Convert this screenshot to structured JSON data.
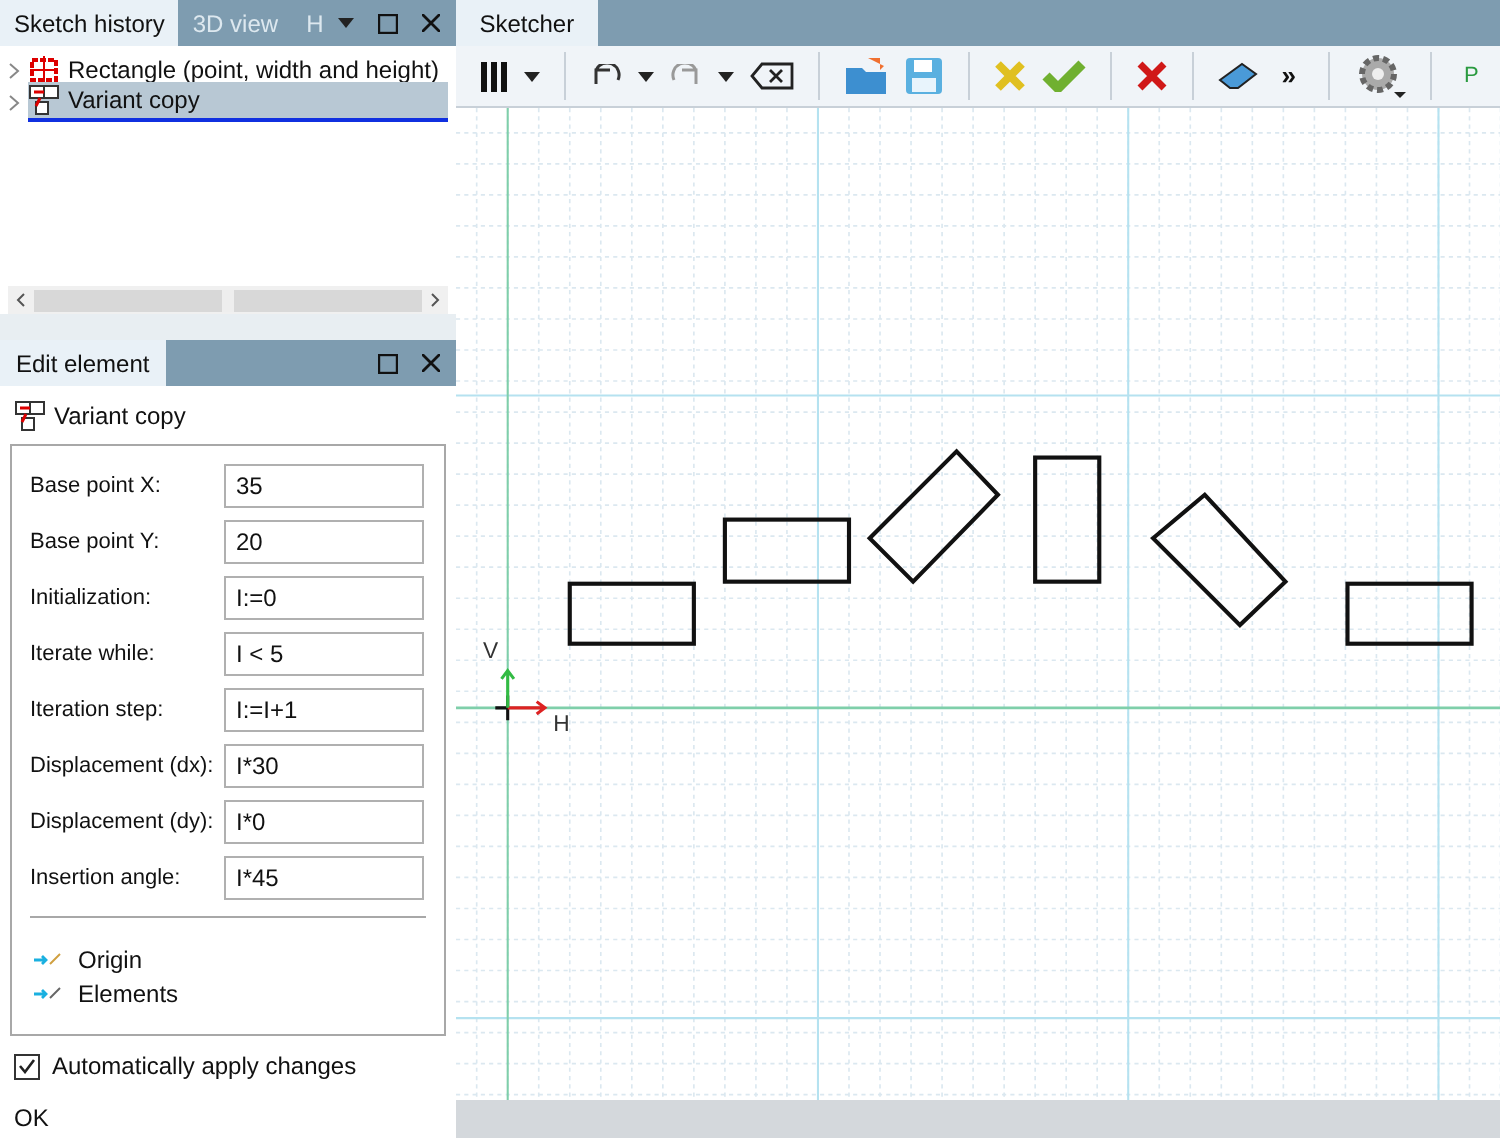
{
  "left_tabs": [
    {
      "label": "Sketch history",
      "selected": true
    },
    {
      "label": "3D view",
      "selected": false
    },
    {
      "label": "H",
      "selected": false
    }
  ],
  "sketch_history": [
    {
      "label": "Rectangle (point, width and height)",
      "selected": false,
      "kind": "rectangle"
    },
    {
      "label": "Variant copy",
      "selected": true,
      "kind": "variant"
    }
  ],
  "edit_panel": {
    "tab": "Edit element",
    "element_title": "Variant copy",
    "fields": [
      {
        "label": "Base point X:",
        "value": "35"
      },
      {
        "label": "Base point Y:",
        "value": "20"
      },
      {
        "label": "Initialization:",
        "value": "I:=0"
      },
      {
        "label": "Iterate while:",
        "value": "I < 5"
      },
      {
        "label": "Iteration step:",
        "value": "I:=I+1"
      },
      {
        "label": "Displacement (dx):",
        "value": "I*30"
      },
      {
        "label": "Displacement (dy):",
        "value": "I*0"
      },
      {
        "label": "Insertion angle:",
        "value": "I*45"
      }
    ],
    "links": [
      "Origin",
      "Elements"
    ],
    "auto_apply": {
      "label": "Automatically apply changes",
      "checked": true
    },
    "status": "OK"
  },
  "sketcher": {
    "tab": "Sketcher",
    "more": "»",
    "point_tool": "P",
    "axis_v": "V",
    "axis_h": "H"
  }
}
